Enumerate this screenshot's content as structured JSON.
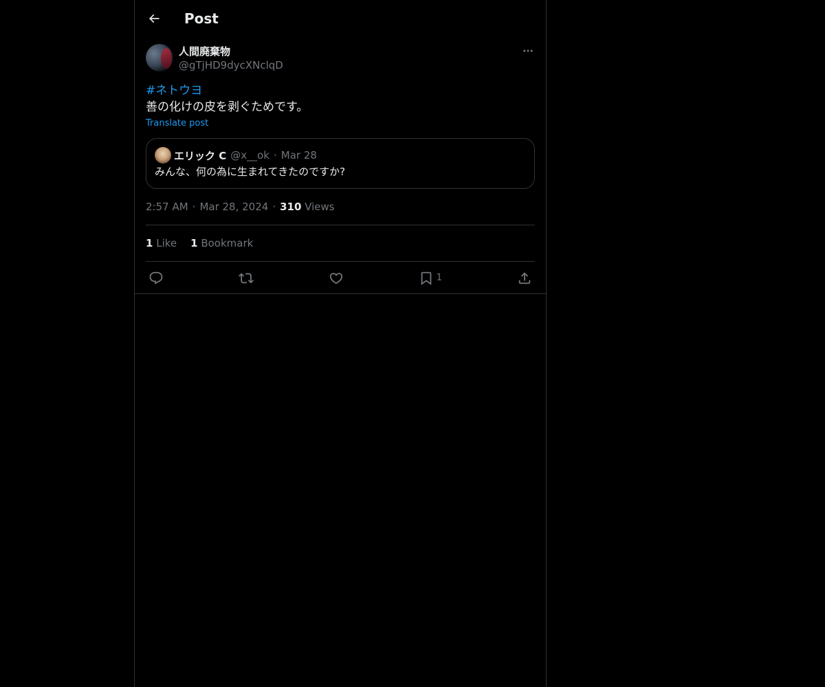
{
  "header": {
    "title": "Post"
  },
  "post": {
    "author_name": "人間廃棄物",
    "author_handle": "@gTjHD9dycXNclqD",
    "hashtag": "#ネトウヨ",
    "text": "善の化けの皮を剥ぐためです。",
    "translate_label": "Translate post",
    "quote": {
      "name": "エリック C",
      "handle": "@x__ok",
      "separator": "·",
      "date": "Mar 28",
      "text": "みんな、何の為に生まれてきたのですか?"
    },
    "meta": {
      "time": "2:57 AM",
      "separator": "·",
      "date": "Mar 28, 2024",
      "views_count": "310",
      "views_label": "Views"
    },
    "stats": {
      "likes_count": "1",
      "likes_label": "Like",
      "bookmarks_count": "1",
      "bookmarks_label": "Bookmark"
    },
    "actions": {
      "bookmark_count": "1"
    }
  },
  "colors": {
    "background": "#000000",
    "text": "#e7e9ea",
    "muted": "#71767b",
    "accent": "#1d9bf0",
    "border": "#2f3336"
  },
  "icons": [
    "back-arrow-icon",
    "more-icon",
    "reply-icon",
    "repost-icon",
    "like-icon",
    "bookmark-icon",
    "share-icon"
  ]
}
